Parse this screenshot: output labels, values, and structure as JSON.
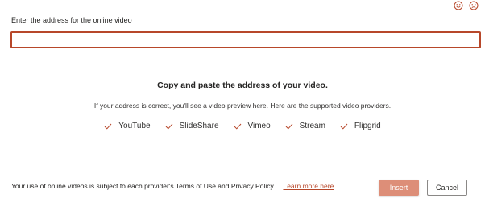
{
  "colors": {
    "accent": "#b7472a",
    "insert_button_bg": "#dd8e78",
    "text": "#252423"
  },
  "feedback": {
    "smile_icon": "smile-icon",
    "frown_icon": "frown-icon"
  },
  "url_field": {
    "label": "Enter the address for the online video",
    "value": "",
    "placeholder": ""
  },
  "info": {
    "heading": "Copy and paste the address of your video.",
    "description": "If your address is correct, you'll see a video preview here. Here are the supported video providers."
  },
  "providers": [
    {
      "name": "YouTube",
      "icon": "check-icon"
    },
    {
      "name": "SlideShare",
      "icon": "check-icon"
    },
    {
      "name": "Vimeo",
      "icon": "check-icon"
    },
    {
      "name": "Stream",
      "icon": "check-icon"
    },
    {
      "name": "Flipgrid",
      "icon": "check-icon"
    }
  ],
  "footer": {
    "terms_text": "Your use of online videos is subject to each provider's Terms of Use and Privacy Policy.",
    "learn_more": "Learn more here"
  },
  "buttons": {
    "insert": "Insert",
    "cancel": "Cancel"
  }
}
